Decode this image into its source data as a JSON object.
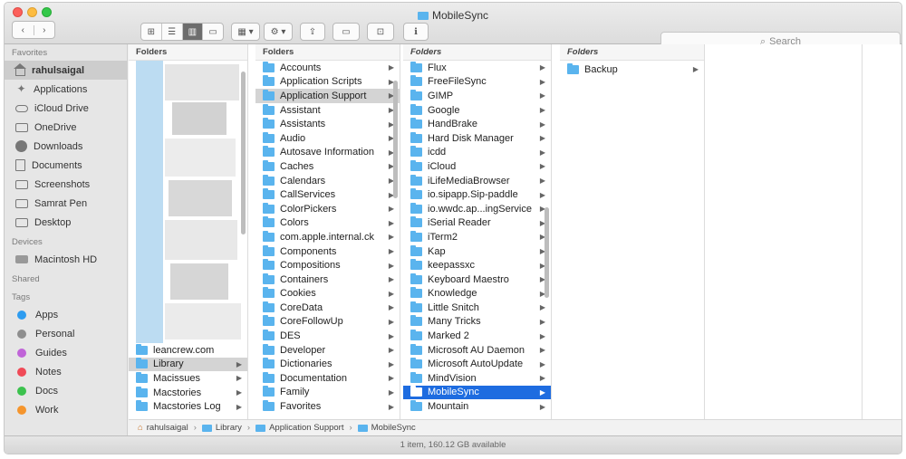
{
  "window": {
    "title": "MobileSync"
  },
  "toolbar": {
    "back": "‹",
    "forward": "›",
    "view_icons": [
      "⊞",
      "☰",
      "▥",
      "▭"
    ],
    "group": "▦ ▾",
    "action": "⚙ ▾",
    "share": "⇪",
    "tag": "▭",
    "newfolder": "⊡",
    "info": "ℹ"
  },
  "search": {
    "placeholder": "Search",
    "icon": "search-icon"
  },
  "sidebar": {
    "favorites_header": "Favorites",
    "favorites": [
      {
        "label": "rahulsaigal",
        "icon": "home-icon"
      },
      {
        "label": "Applications",
        "icon": "applications-icon"
      },
      {
        "label": "iCloud Drive",
        "icon": "cloud-icon"
      },
      {
        "label": "OneDrive",
        "icon": "folder-icon"
      },
      {
        "label": "Downloads",
        "icon": "download-icon"
      },
      {
        "label": "Documents",
        "icon": "document-icon"
      },
      {
        "label": "Screenshots",
        "icon": "folder-icon"
      },
      {
        "label": "Samrat Pen",
        "icon": "folder-icon"
      },
      {
        "label": "Desktop",
        "icon": "folder-icon"
      }
    ],
    "devices_header": "Devices",
    "devices": [
      {
        "label": "Macintosh HD",
        "icon": "drive-icon"
      }
    ],
    "shared_header": "Shared",
    "tags_header": "Tags",
    "tags": [
      {
        "label": "Apps",
        "color": "#2d9cf0"
      },
      {
        "label": "Personal",
        "color": "#8e8e8e"
      },
      {
        "label": "Guides",
        "color": "#c064d8"
      },
      {
        "label": "Notes",
        "color": "#f04a57"
      },
      {
        "label": "Docs",
        "color": "#3cc24e"
      },
      {
        "label": "Work",
        "color": "#f5952d"
      }
    ]
  },
  "columns": {
    "col1": {
      "header": "Folders",
      "items": [
        "leancrew.com",
        "Library",
        "Macissues",
        "Macstories",
        "Macstories Log"
      ]
    },
    "col2": {
      "header": "Folders",
      "items": [
        "Accounts",
        "Application Scripts",
        "Application Support",
        "Assistant",
        "Assistants",
        "Audio",
        "Autosave Information",
        "Caches",
        "Calendars",
        "CallServices",
        "ColorPickers",
        "Colors",
        "com.apple.internal.ck",
        "Components",
        "Compositions",
        "Containers",
        "Cookies",
        "CoreData",
        "CoreFollowUp",
        "DES",
        "Developer",
        "Dictionaries",
        "Documentation",
        "Family",
        "Favorites"
      ]
    },
    "col3": {
      "header": "Folders",
      "items": [
        "Flux",
        "FreeFileSync",
        "GIMP",
        "Google",
        "HandBrake",
        "Hard Disk Manager",
        "icdd",
        "iCloud",
        "iLifeMediaBrowser",
        "io.sipapp.Sip-paddle",
        "io.wwdc.ap...ingService",
        "iSerial Reader",
        "iTerm2",
        "Kap",
        "keepassxc",
        "Keyboard Maestro",
        "Knowledge",
        "Little Snitch",
        "Many Tricks",
        "Marked 2",
        "Microsoft AU Daemon",
        "Microsoft AutoUpdate",
        "MindVision",
        "MobileSync",
        "Mountain"
      ]
    },
    "col4": {
      "header": "Folders",
      "items": [
        "Backup"
      ]
    }
  },
  "pathbar": [
    "rahulsaigal",
    "Library",
    "Application Support",
    "MobileSync"
  ],
  "status": "1 item, 160.12 GB available",
  "colors": {
    "selection": "#1e6ce0",
    "folder": "#5ab4ee"
  }
}
